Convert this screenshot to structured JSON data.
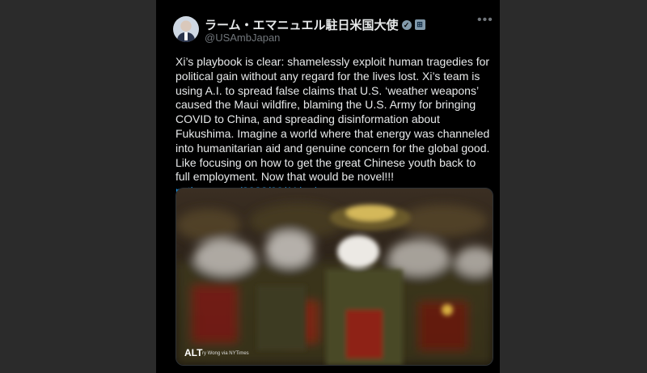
{
  "author": {
    "display_name": "ラーム・エマニュエル駐日米国大使",
    "handle": "@USAmbJapan",
    "verified_glyph": "✓",
    "gov_glyph": "⊞"
  },
  "menu": {
    "more_glyph": "•••"
  },
  "tweet": {
    "text": "Xi’s playbook is clear: shamelessly exploit human tragedies for political gain without any regard for the lives lost. Xi’s team is using A.I. to spread false claims that U.S. ‘weather weapons’ caused the Maui wildfire, blaming the U.S. Army for bringing COVID to China, and spreading disinformation about Fukushima. Imagine a world where that energy was channeled into humanitarian aid and genuine concern for the global good. Like focusing on how to get the great Chinese youth back to full employment. Now that would be novel!!!",
    "link": "nytimes.com/2023/09/11/us/..."
  },
  "media": {
    "alt_label": "ALT",
    "credit": "ry Wong via NYTimes"
  },
  "colors": {
    "background": "#000000",
    "text": "#e7e9ea",
    "secondary": "#71767b",
    "link": "#1d9bf0"
  }
}
